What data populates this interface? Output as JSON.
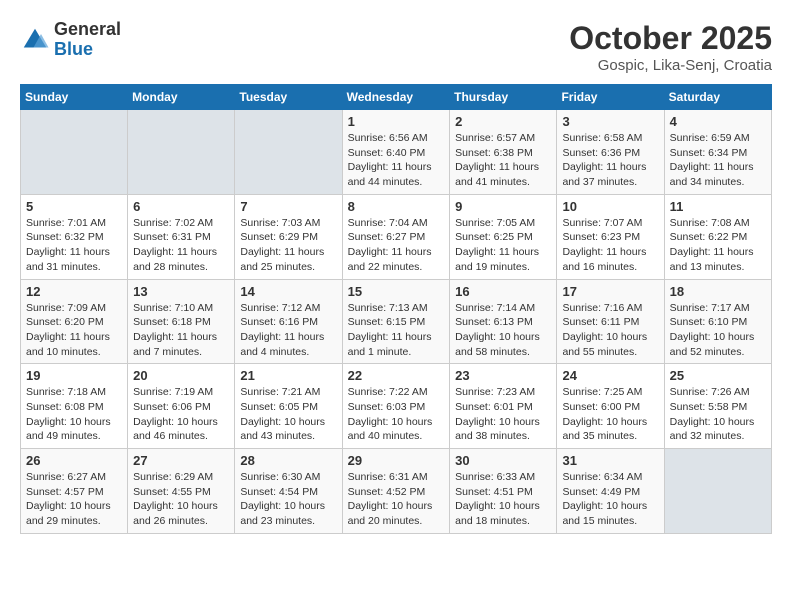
{
  "header": {
    "logo_general": "General",
    "logo_blue": "Blue",
    "month": "October 2025",
    "location": "Gospic, Lika-Senj, Croatia"
  },
  "weekdays": [
    "Sunday",
    "Monday",
    "Tuesday",
    "Wednesday",
    "Thursday",
    "Friday",
    "Saturday"
  ],
  "weeks": [
    [
      {
        "day": "",
        "info": ""
      },
      {
        "day": "",
        "info": ""
      },
      {
        "day": "",
        "info": ""
      },
      {
        "day": "1",
        "info": "Sunrise: 6:56 AM\nSunset: 6:40 PM\nDaylight: 11 hours\nand 44 minutes."
      },
      {
        "day": "2",
        "info": "Sunrise: 6:57 AM\nSunset: 6:38 PM\nDaylight: 11 hours\nand 41 minutes."
      },
      {
        "day": "3",
        "info": "Sunrise: 6:58 AM\nSunset: 6:36 PM\nDaylight: 11 hours\nand 37 minutes."
      },
      {
        "day": "4",
        "info": "Sunrise: 6:59 AM\nSunset: 6:34 PM\nDaylight: 11 hours\nand 34 minutes."
      }
    ],
    [
      {
        "day": "5",
        "info": "Sunrise: 7:01 AM\nSunset: 6:32 PM\nDaylight: 11 hours\nand 31 minutes."
      },
      {
        "day": "6",
        "info": "Sunrise: 7:02 AM\nSunset: 6:31 PM\nDaylight: 11 hours\nand 28 minutes."
      },
      {
        "day": "7",
        "info": "Sunrise: 7:03 AM\nSunset: 6:29 PM\nDaylight: 11 hours\nand 25 minutes."
      },
      {
        "day": "8",
        "info": "Sunrise: 7:04 AM\nSunset: 6:27 PM\nDaylight: 11 hours\nand 22 minutes."
      },
      {
        "day": "9",
        "info": "Sunrise: 7:05 AM\nSunset: 6:25 PM\nDaylight: 11 hours\nand 19 minutes."
      },
      {
        "day": "10",
        "info": "Sunrise: 7:07 AM\nSunset: 6:23 PM\nDaylight: 11 hours\nand 16 minutes."
      },
      {
        "day": "11",
        "info": "Sunrise: 7:08 AM\nSunset: 6:22 PM\nDaylight: 11 hours\nand 13 minutes."
      }
    ],
    [
      {
        "day": "12",
        "info": "Sunrise: 7:09 AM\nSunset: 6:20 PM\nDaylight: 11 hours\nand 10 minutes."
      },
      {
        "day": "13",
        "info": "Sunrise: 7:10 AM\nSunset: 6:18 PM\nDaylight: 11 hours\nand 7 minutes."
      },
      {
        "day": "14",
        "info": "Sunrise: 7:12 AM\nSunset: 6:16 PM\nDaylight: 11 hours\nand 4 minutes."
      },
      {
        "day": "15",
        "info": "Sunrise: 7:13 AM\nSunset: 6:15 PM\nDaylight: 11 hours\nand 1 minute."
      },
      {
        "day": "16",
        "info": "Sunrise: 7:14 AM\nSunset: 6:13 PM\nDaylight: 10 hours\nand 58 minutes."
      },
      {
        "day": "17",
        "info": "Sunrise: 7:16 AM\nSunset: 6:11 PM\nDaylight: 10 hours\nand 55 minutes."
      },
      {
        "day": "18",
        "info": "Sunrise: 7:17 AM\nSunset: 6:10 PM\nDaylight: 10 hours\nand 52 minutes."
      }
    ],
    [
      {
        "day": "19",
        "info": "Sunrise: 7:18 AM\nSunset: 6:08 PM\nDaylight: 10 hours\nand 49 minutes."
      },
      {
        "day": "20",
        "info": "Sunrise: 7:19 AM\nSunset: 6:06 PM\nDaylight: 10 hours\nand 46 minutes."
      },
      {
        "day": "21",
        "info": "Sunrise: 7:21 AM\nSunset: 6:05 PM\nDaylight: 10 hours\nand 43 minutes."
      },
      {
        "day": "22",
        "info": "Sunrise: 7:22 AM\nSunset: 6:03 PM\nDaylight: 10 hours\nand 40 minutes."
      },
      {
        "day": "23",
        "info": "Sunrise: 7:23 AM\nSunset: 6:01 PM\nDaylight: 10 hours\nand 38 minutes."
      },
      {
        "day": "24",
        "info": "Sunrise: 7:25 AM\nSunset: 6:00 PM\nDaylight: 10 hours\nand 35 minutes."
      },
      {
        "day": "25",
        "info": "Sunrise: 7:26 AM\nSunset: 5:58 PM\nDaylight: 10 hours\nand 32 minutes."
      }
    ],
    [
      {
        "day": "26",
        "info": "Sunrise: 6:27 AM\nSunset: 4:57 PM\nDaylight: 10 hours\nand 29 minutes."
      },
      {
        "day": "27",
        "info": "Sunrise: 6:29 AM\nSunset: 4:55 PM\nDaylight: 10 hours\nand 26 minutes."
      },
      {
        "day": "28",
        "info": "Sunrise: 6:30 AM\nSunset: 4:54 PM\nDaylight: 10 hours\nand 23 minutes."
      },
      {
        "day": "29",
        "info": "Sunrise: 6:31 AM\nSunset: 4:52 PM\nDaylight: 10 hours\nand 20 minutes."
      },
      {
        "day": "30",
        "info": "Sunrise: 6:33 AM\nSunset: 4:51 PM\nDaylight: 10 hours\nand 18 minutes."
      },
      {
        "day": "31",
        "info": "Sunrise: 6:34 AM\nSunset: 4:49 PM\nDaylight: 10 hours\nand 15 minutes."
      },
      {
        "day": "",
        "info": ""
      }
    ]
  ]
}
